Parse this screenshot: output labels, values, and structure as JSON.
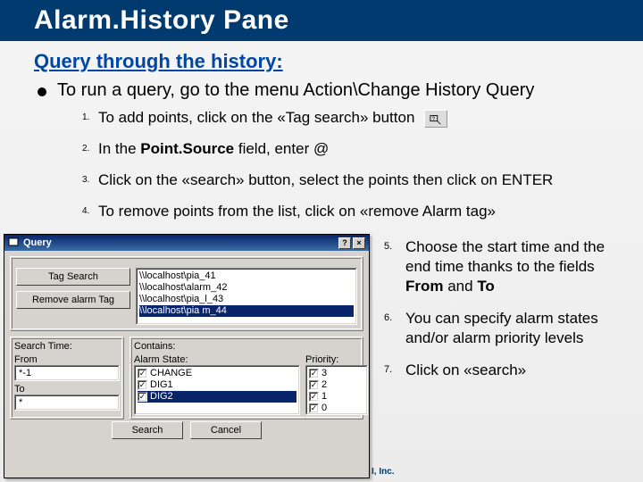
{
  "title": "Alarm.History Pane",
  "subtitle": "Query through the history:",
  "lead": "To run a query, go to the menu Action\\Change History Query",
  "steps": {
    "s1_a": "To add points, click on the «Tag search» button",
    "s2_a": "In the ",
    "s2_b": "Point.Source",
    "s2_c": " field, enter @",
    "s3": "Click on the «search» button, select the points then click on ENTER",
    "s4": "To remove points from the list, click on «remove Alarm tag»",
    "s5_a": "Choose the start time and the end time thanks to the fields ",
    "s5_b": "From",
    "s5_c": " and ",
    "s5_d": "To",
    "s6": "You can specify alarm states and/or alarm priority levels",
    "s7": "Click on «search»"
  },
  "nums": {
    "n1": "1.",
    "n2": "2.",
    "n3": "3.",
    "n4": "4.",
    "n5": "5.",
    "n6": "6.",
    "n7": "7."
  },
  "dialog": {
    "title": "Query",
    "tag_search": "Tag Search",
    "remove": "Remove alarm Tag",
    "search_time": "Search Time:",
    "from": "From",
    "to": "To",
    "from_val": "*-1",
    "to_val": "*",
    "contains": "Contains:",
    "alarm_state": "Alarm State:",
    "priority": "Priority:",
    "search": "Search",
    "cancel": "Cancel",
    "list": [
      "\\\\localhost\\pia_41",
      "\\\\localhost\\alarm_42",
      "\\\\localhost\\pia_l_43",
      "\\\\localhost\\pia m_44"
    ],
    "states": [
      "CHANGE",
      "DIG1",
      "DIG2"
    ],
    "priorities": [
      "3",
      "2",
      "1",
      "0"
    ]
  },
  "footer": "I, Inc."
}
